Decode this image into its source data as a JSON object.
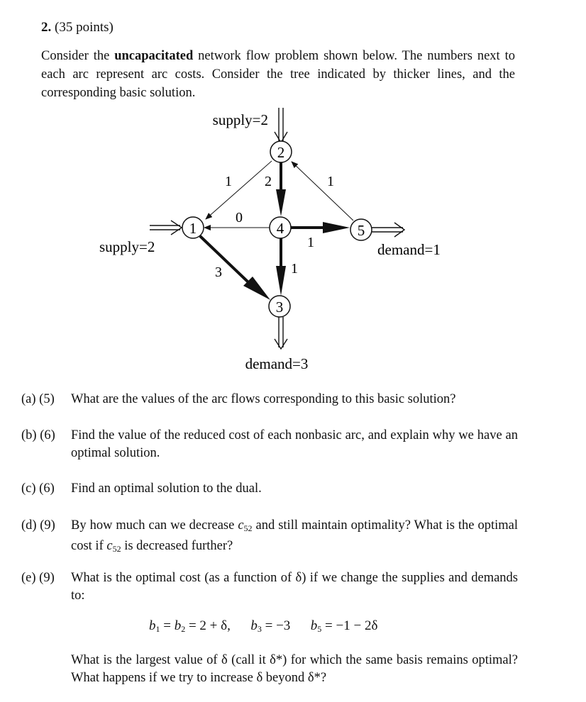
{
  "problem": {
    "number": "2.",
    "points": "(35 points)",
    "intro_before_bold": "Consider the ",
    "intro_bold": "uncapacitated",
    "intro_after_bold": " network flow problem shown below. The numbers next to each arc represent arc costs. Consider the tree indicated by thicker lines, and the corresponding basic solution."
  },
  "graph": {
    "nodes": [
      {
        "id": "1",
        "label": "1"
      },
      {
        "id": "2",
        "label": "2"
      },
      {
        "id": "3",
        "label": "3"
      },
      {
        "id": "4",
        "label": "4"
      },
      {
        "id": "5",
        "label": "5"
      }
    ],
    "arcs": [
      {
        "from": "2",
        "to": "1",
        "cost": "1",
        "tree": false
      },
      {
        "from": "2",
        "to": "4",
        "cost": "2",
        "tree": true
      },
      {
        "from": "5",
        "to": "2",
        "cost": "1",
        "tree": false
      },
      {
        "from": "4",
        "to": "1",
        "cost": "0",
        "tree": false
      },
      {
        "from": "4",
        "to": "5",
        "cost": "1",
        "tree": true
      },
      {
        "from": "1",
        "to": "3",
        "cost": "3",
        "tree": true
      },
      {
        "from": "4",
        "to": "3",
        "cost": "1",
        "tree": true
      }
    ],
    "external": [
      {
        "node": "2",
        "label": "supply=2"
      },
      {
        "node": "1",
        "label": "supply=2"
      },
      {
        "node": "5",
        "label": "demand=1"
      },
      {
        "node": "3",
        "label": "demand=3"
      }
    ]
  },
  "questions": [
    {
      "part": "(a)",
      "points": "(5)",
      "text": "What are the values of the arc flows corresponding to this basic solution?"
    },
    {
      "part": "(b)",
      "points": "(6)",
      "text": "Find the value of the reduced cost of each nonbasic arc, and explain why we have an optimal solution."
    },
    {
      "part": "(c)",
      "points": "(6)",
      "text": "Find an optimal solution to the dual."
    },
    {
      "part": "(d)",
      "points": "(9)",
      "text_1": "By how much can we decrease ",
      "var": "c",
      "var_sub": "52",
      "text_2": " and still maintain optimality? What is the optimal cost if ",
      "text_3": " is decreased further?"
    },
    {
      "part": "(e)",
      "points": "(9)",
      "text": "What is the optimal cost (as a function of δ) if we change the supplies and demands to:",
      "equation": {
        "b1": "b",
        "b1_sub": "1",
        "b2_sub": "2",
        "rhs1": " = 2 + δ,",
        "b3_sub": "3",
        "rhs3": " = −3",
        "b5_sub": "5",
        "rhs5": " = −1 − 2δ"
      },
      "followup": "What is the largest value of δ (call it δ*) for which the same basis remains optimal? What happens if we try to increase δ beyond δ*?"
    }
  ]
}
